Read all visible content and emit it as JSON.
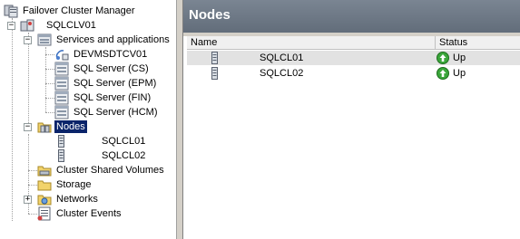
{
  "tree": {
    "root_label": "Failover Cluster Manager",
    "cluster_label": "SQLCLV01",
    "services_label": "Services and applications",
    "services_items": [
      "DEVMSDTCV01",
      "SQL Server (CS)",
      "SQL Server (EPM)",
      "SQL Server (FIN)",
      "SQL Server (HCM)"
    ],
    "nodes_label": "Nodes",
    "node_items": [
      "SQLCL01",
      "SQLCL02"
    ],
    "csv_label": "Cluster Shared Volumes",
    "storage_label": "Storage",
    "networks_label": "Networks",
    "events_label": "Cluster Events",
    "expander_collapse": "−",
    "expander_expand": "+"
  },
  "right": {
    "title": "Nodes",
    "columns": {
      "name": "Name",
      "status": "Status"
    },
    "rows": [
      {
        "name": "SQLCL01",
        "status": "Up"
      },
      {
        "name": "SQLCL02",
        "status": "Up"
      }
    ]
  },
  "colors": {
    "header_bg": "#6c7784",
    "selection_bg": "#0a246a",
    "status_up": "#2e9b2e"
  },
  "icons": {
    "root": "failover-cluster-manager-icon",
    "cluster": "cluster-icon",
    "services": "services-folder-icon",
    "msdtc": "msdtc-service-icon",
    "sql": "sql-server-service-icon",
    "nodes": "nodes-folder-icon",
    "node": "server-node-icon",
    "csv": "shared-volumes-icon",
    "storage": "storage-icon",
    "networks": "networks-icon",
    "events": "cluster-events-icon",
    "status_up": "status-up-icon"
  }
}
